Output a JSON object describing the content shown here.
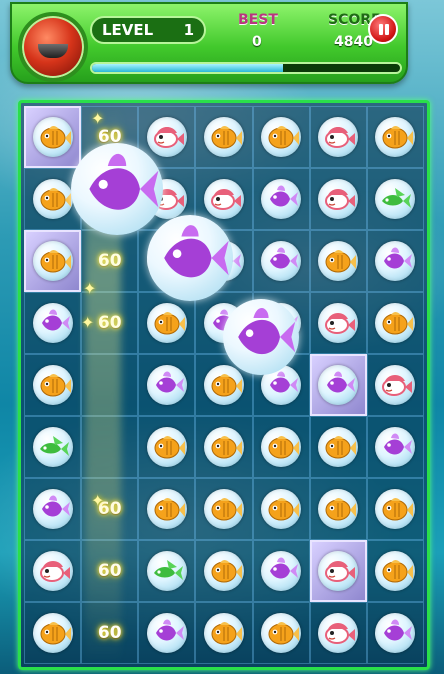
{
  "hud": {
    "level_label": "LEVEL",
    "level_value": "1",
    "best_label": "BEST",
    "best_value": "0",
    "score_label": "SCORE",
    "score_value": "4840",
    "progress_fraction": 0.62
  },
  "points_popup": "60",
  "board": {
    "rows": [
      [
        "orange-fish",
        "pts",
        "pink-fish",
        "orange-fish",
        "orange-fish",
        "pink-fish",
        "orange-fish"
      ],
      [
        "orange-fish",
        "pts",
        "pink-fish",
        "pink-fish",
        "purple-fish",
        "pink-fish",
        "green-fish"
      ],
      [
        "orange-fish",
        "pts",
        "purple-fish",
        "purple-fish",
        "purple-fish",
        "orange-fish",
        "purple-fish"
      ],
      [
        "purple-fish",
        "pts",
        "orange-fish",
        "purple-fish",
        "purple-fish",
        "pink-fish",
        "orange-fish"
      ],
      [
        "orange-fish",
        "glow",
        "purple-fish",
        "orange-fish",
        "purple-fish",
        "purple-fish",
        "pink-fish"
      ],
      [
        "green-fish",
        "glow",
        "orange-fish",
        "orange-fish",
        "orange-fish",
        "orange-fish",
        "purple-fish"
      ],
      [
        "purple-fish",
        "pts",
        "orange-fish",
        "orange-fish",
        "orange-fish",
        "orange-fish",
        "orange-fish"
      ],
      [
        "pink-fish",
        "pts",
        "green-fish",
        "orange-fish",
        "purple-fish",
        "pink-fish",
        "orange-fish"
      ],
      [
        "orange-fish",
        "pts",
        "purple-fish",
        "orange-fish",
        "orange-fish",
        "pink-fish",
        "purple-fish"
      ]
    ],
    "selected_cells": [
      [
        0,
        0
      ],
      [
        2,
        0
      ],
      [
        4,
        5
      ],
      [
        7,
        5
      ]
    ],
    "colors": {
      "orange-fish": "#f5a21b",
      "pink-fish": "#e8607a",
      "purple-fish": "#a53fd6",
      "green-fish": "#3ebc3e"
    }
  }
}
